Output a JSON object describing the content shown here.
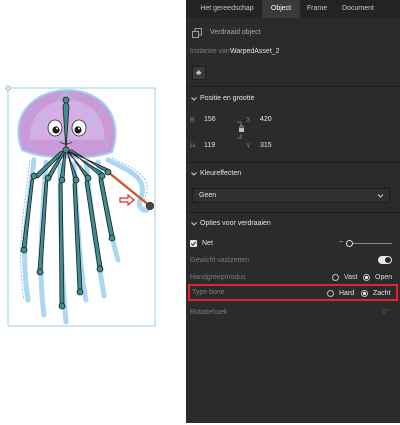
{
  "tabs": [
    {
      "label": "Het gereedschap",
      "active": false
    },
    {
      "label": "Object",
      "active": true
    },
    {
      "label": "Frame",
      "active": false
    },
    {
      "label": "Document",
      "active": false
    }
  ],
  "object_header": {
    "icon": "warp-object-icon",
    "type_label": "Verdraaid object",
    "instance_label": "Instantie van",
    "instance_name": "WarpedAsset_2",
    "library_button_icon": "symbol-icon"
  },
  "position_size": {
    "title": "Positie en grootte",
    "w_label": "B",
    "w_value": "156",
    "x_label": "X",
    "x_value": "420",
    "h_label": "H",
    "h_value": "119",
    "y_label": "Y",
    "y_value": "315",
    "link_icon": "lock-icon"
  },
  "color_effects": {
    "title": "Kleureffecten",
    "dropdown_value": "Geen"
  },
  "warp_options": {
    "title": "Opties voor verdraaien",
    "net_label": "Net",
    "net_checked": true,
    "net_slider_minus": "−",
    "fix_weight_label": "Gewicht vastzetten",
    "handle_mode_label": "Handgreepmodus",
    "handle_options": [
      {
        "label": "Vast",
        "selected": false
      },
      {
        "label": "Open",
        "selected": true
      }
    ],
    "bone_type_label": "Type bone",
    "bone_options": [
      {
        "label": "Hard",
        "selected": false
      },
      {
        "label": "Zacht",
        "selected": true
      }
    ],
    "rotation_label": "Rotatiehoek",
    "rotation_value": "0°"
  },
  "colors": {
    "panel_bg": "#2b2b2b",
    "tab_bar_bg": "#232323",
    "highlight_border": "#e0232f",
    "toggle_on": "#ffffff",
    "jelly_body": "#c89ad8",
    "jelly_tentacles": "#9fd0ee",
    "bone_fill": "#3f8e92",
    "selected_bone": "#c85a2a",
    "pointer_arrow": "#d62a2a"
  }
}
